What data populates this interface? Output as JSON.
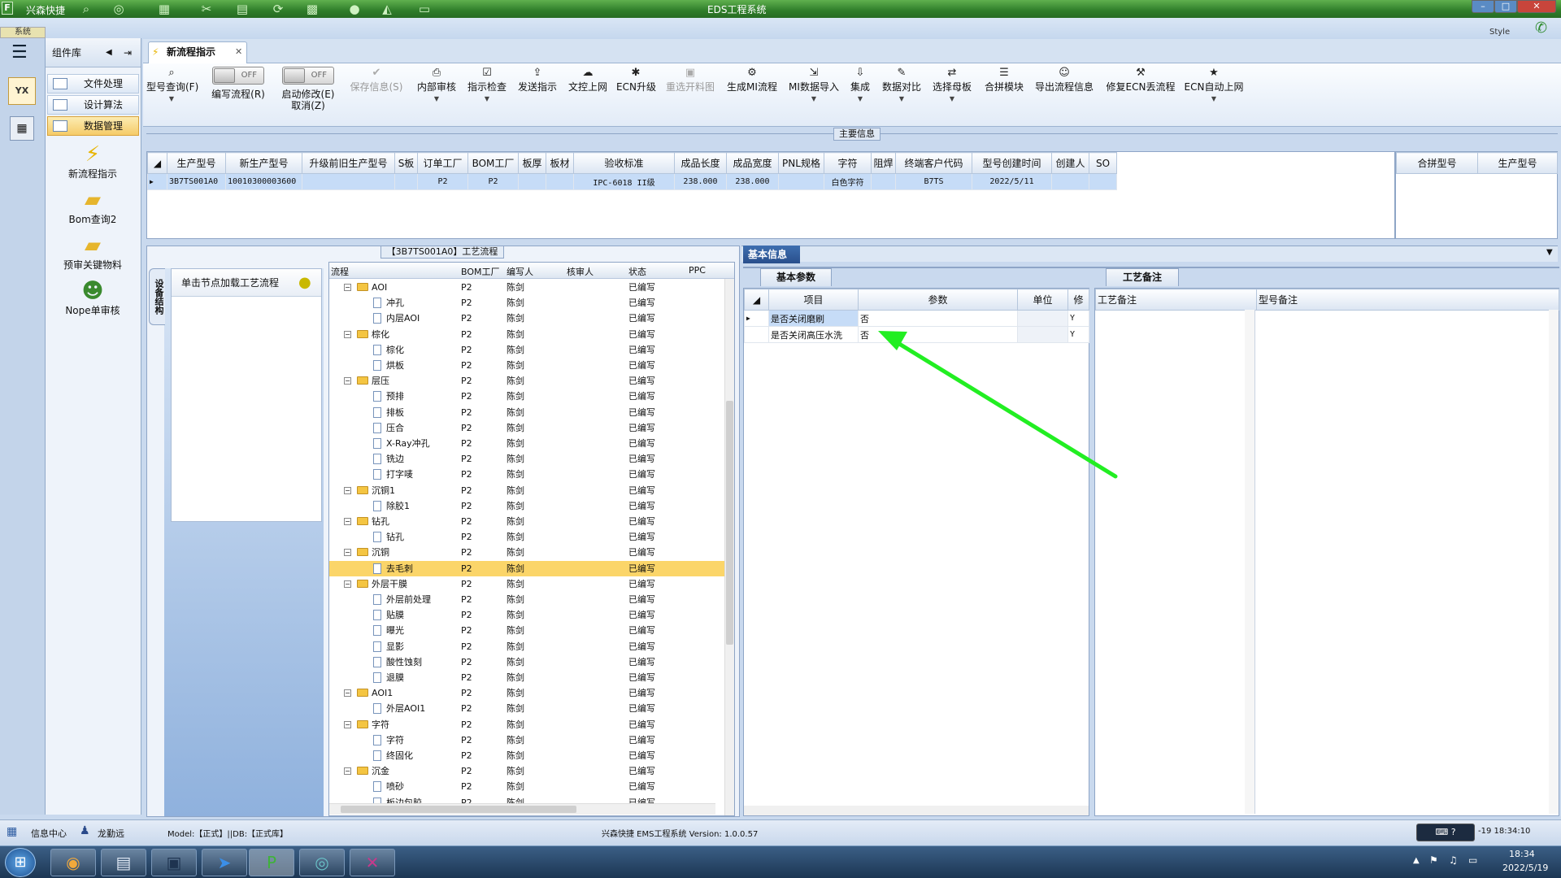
{
  "app": {
    "title": "EDS工程系统",
    "brand": "兴森快捷",
    "system_label": "系统",
    "style_label": "Style"
  },
  "complib": {
    "title": "组件库",
    "items": [
      {
        "label": "文件处理"
      },
      {
        "label": "设计算法"
      },
      {
        "label": "数据管理"
      }
    ],
    "big_items": [
      {
        "label": "新流程指示"
      },
      {
        "label": "Bom查询2"
      },
      {
        "label": "预审关键物料"
      },
      {
        "label": "Nope单审核"
      }
    ]
  },
  "tab": {
    "label": "新流程指示"
  },
  "toolbar": {
    "items": [
      {
        "label": "型号查询(F)",
        "icon": "search-icon"
      },
      {
        "label": "编写流程(R)",
        "toggle": "OFF"
      },
      {
        "label": "启动修改(E)",
        "toggle": "OFF",
        "sub": "取消(Z)"
      },
      {
        "label": "保存信息(S)",
        "icon": "check-icon"
      },
      {
        "label": "内部审核",
        "icon": "printer-icon"
      },
      {
        "label": "指示检查",
        "icon": "checkbox-icon"
      },
      {
        "label": "发送指示",
        "icon": "send-icon"
      },
      {
        "label": "文控上网",
        "icon": "upload-icon"
      },
      {
        "label": "ECN升级",
        "icon": "bug-icon"
      },
      {
        "label": "重选开料图",
        "icon": "image-icon"
      },
      {
        "label": "生成MI流程",
        "icon": "gears-icon"
      },
      {
        "label": "MI数据导入",
        "icon": "import-icon"
      },
      {
        "label": "集成",
        "icon": "download-icon"
      },
      {
        "label": "数据对比",
        "icon": "compare-icon"
      },
      {
        "label": "选择母板",
        "icon": "shuffle-icon"
      },
      {
        "label": "合拼模块",
        "icon": "list-icon"
      },
      {
        "label": "导出流程信息",
        "icon": "smile-icon"
      },
      {
        "label": "修复ECN丢流程",
        "icon": "wrench-icon"
      },
      {
        "label": "ECN自动上网",
        "icon": "star-icon"
      }
    ]
  },
  "main": {
    "header_label": "主要信息",
    "columns": [
      "生产型号",
      "新生产型号",
      "升级前旧生产型号",
      "S板",
      "订单工厂",
      "BOM工厂",
      "板厚",
      "板材",
      "验收标准",
      "成品长度",
      "成品宽度",
      "PNL规格",
      "字符",
      "阻焊",
      "终端客户代码",
      "型号创建时间",
      "创建人",
      "SO"
    ],
    "rows": [
      [
        "3B7TS001A0",
        "10010300003600",
        "",
        "",
        "P2",
        "P2",
        "",
        "",
        "IPC-6018 II级",
        "238.000",
        "238.000",
        "",
        "白色字符",
        "",
        "B7TS",
        "2022/5/11",
        "",
        ""
      ]
    ],
    "merge_columns": [
      "合拼型号",
      "生产型号"
    ]
  },
  "process": {
    "title": "【3B7TS001A0】工艺流程",
    "side_tab": "设备结构",
    "load_button": "单击节点加载工艺流程",
    "columns": [
      "流程",
      "BOM工厂",
      "编写人",
      "核审人",
      "状态",
      "PPC"
    ],
    "rows": [
      {
        "name": "AOI",
        "type": "folder",
        "level": 1,
        "factory": "P2",
        "writer": "陈剑",
        "status": "已编写"
      },
      {
        "name": "冲孔",
        "type": "doc",
        "level": 2,
        "factory": "P2",
        "writer": "陈剑",
        "status": "已编写"
      },
      {
        "name": "内层AOI",
        "type": "doc",
        "level": 2,
        "factory": "P2",
        "writer": "陈剑",
        "status": "已编写"
      },
      {
        "name": "棕化",
        "type": "folder",
        "level": 1,
        "factory": "P2",
        "writer": "陈剑",
        "status": "已编写"
      },
      {
        "name": "棕化",
        "type": "doc",
        "level": 2,
        "factory": "P2",
        "writer": "陈剑",
        "status": "已编写"
      },
      {
        "name": "烘板",
        "type": "doc",
        "level": 2,
        "factory": "P2",
        "writer": "陈剑",
        "status": "已编写"
      },
      {
        "name": "层压",
        "type": "folder",
        "level": 1,
        "factory": "P2",
        "writer": "陈剑",
        "status": "已编写"
      },
      {
        "name": "预排",
        "type": "doc",
        "level": 2,
        "factory": "P2",
        "writer": "陈剑",
        "status": "已编写"
      },
      {
        "name": "排板",
        "type": "doc",
        "level": 2,
        "factory": "P2",
        "writer": "陈剑",
        "status": "已编写"
      },
      {
        "name": "压合",
        "type": "doc",
        "level": 2,
        "factory": "P2",
        "writer": "陈剑",
        "status": "已编写"
      },
      {
        "name": "X-Ray冲孔",
        "type": "doc",
        "level": 2,
        "factory": "P2",
        "writer": "陈剑",
        "status": "已编写"
      },
      {
        "name": "铣边",
        "type": "doc",
        "level": 2,
        "factory": "P2",
        "writer": "陈剑",
        "status": "已编写"
      },
      {
        "name": "打字唛",
        "type": "doc",
        "level": 2,
        "factory": "P2",
        "writer": "陈剑",
        "status": "已编写"
      },
      {
        "name": "沉铜1",
        "type": "folder",
        "level": 1,
        "factory": "P2",
        "writer": "陈剑",
        "status": "已编写"
      },
      {
        "name": "除胶1",
        "type": "doc",
        "level": 2,
        "factory": "P2",
        "writer": "陈剑",
        "status": "已编写"
      },
      {
        "name": "钻孔",
        "type": "folder",
        "level": 1,
        "factory": "P2",
        "writer": "陈剑",
        "status": "已编写"
      },
      {
        "name": "钻孔",
        "type": "doc",
        "level": 2,
        "factory": "P2",
        "writer": "陈剑",
        "status": "已编写"
      },
      {
        "name": "沉铜",
        "type": "folder",
        "level": 1,
        "factory": "P2",
        "writer": "陈剑",
        "status": "已编写"
      },
      {
        "name": "去毛刺",
        "type": "doc",
        "level": 2,
        "factory": "P2",
        "writer": "陈剑",
        "status": "已编写",
        "selected": true
      },
      {
        "name": "外层干膜",
        "type": "folder",
        "level": 1,
        "factory": "P2",
        "writer": "陈剑",
        "status": "已编写"
      },
      {
        "name": "外层前处理",
        "type": "doc",
        "level": 2,
        "factory": "P2",
        "writer": "陈剑",
        "status": "已编写"
      },
      {
        "name": "贴膜",
        "type": "doc",
        "level": 2,
        "factory": "P2",
        "writer": "陈剑",
        "status": "已编写"
      },
      {
        "name": "曝光",
        "type": "doc",
        "level": 2,
        "factory": "P2",
        "writer": "陈剑",
        "status": "已编写"
      },
      {
        "name": "显影",
        "type": "doc",
        "level": 2,
        "factory": "P2",
        "writer": "陈剑",
        "status": "已编写"
      },
      {
        "name": "酸性蚀刻",
        "type": "doc",
        "level": 2,
        "factory": "P2",
        "writer": "陈剑",
        "status": "已编写"
      },
      {
        "name": "退膜",
        "type": "doc",
        "level": 2,
        "factory": "P2",
        "writer": "陈剑",
        "status": "已编写"
      },
      {
        "name": "AOI1",
        "type": "folder",
        "level": 1,
        "factory": "P2",
        "writer": "陈剑",
        "status": "已编写"
      },
      {
        "name": "外层AOI1",
        "type": "doc",
        "level": 2,
        "factory": "P2",
        "writer": "陈剑",
        "status": "已编写"
      },
      {
        "name": "字符",
        "type": "folder",
        "level": 1,
        "factory": "P2",
        "writer": "陈剑",
        "status": "已编写"
      },
      {
        "name": "字符",
        "type": "doc",
        "level": 2,
        "factory": "P2",
        "writer": "陈剑",
        "status": "已编写"
      },
      {
        "name": "终固化",
        "type": "doc",
        "level": 2,
        "factory": "P2",
        "writer": "陈剑",
        "status": "已编写"
      },
      {
        "name": "沉金",
        "type": "folder",
        "level": 1,
        "factory": "P2",
        "writer": "陈剑",
        "status": "已编写"
      },
      {
        "name": "喷砂",
        "type": "doc",
        "level": 2,
        "factory": "P2",
        "writer": "陈剑",
        "status": "已编写"
      },
      {
        "name": "板边包胶",
        "type": "doc",
        "level": 2,
        "factory": "P2",
        "writer": "陈剑",
        "status": "已编写"
      }
    ]
  },
  "basic": {
    "tab": "基本信息",
    "param_tab": "基本参数",
    "columns": [
      "项目",
      "参数",
      "单位",
      "修"
    ],
    "rows": [
      [
        "是否关闭磨刷",
        "否",
        "",
        "Y"
      ],
      [
        "是否关闭高压水洗",
        "否",
        "",
        "Y"
      ]
    ],
    "note_tab": "工艺备注",
    "note_columns": [
      "工艺备注",
      "型号备注"
    ]
  },
  "status": {
    "info_center": "信息中心",
    "user": "龙勤远",
    "model": "Model:【正式】||DB:【正式库】",
    "app_info": "兴森快捷 EMS工程系统 Version: 1.0.0.57",
    "datetime": "-19 18:34:10"
  },
  "taskbar": {
    "time": "18:34",
    "date": "2022/5/19"
  },
  "colors": {
    "accent": "#2f7d2a",
    "selection": "#fbd569",
    "arrow": "#22ee22"
  }
}
